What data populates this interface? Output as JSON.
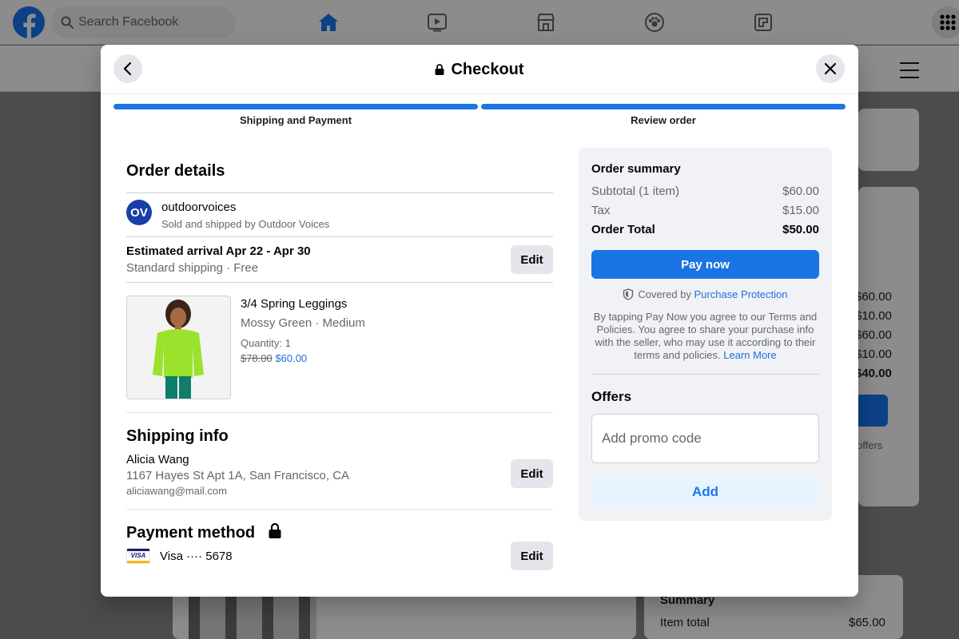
{
  "topbar": {
    "search_placeholder": "Search Facebook",
    "nav_icons": [
      "home-icon",
      "watch-icon",
      "marketplace-icon",
      "groups-icon",
      "gaming-icon"
    ]
  },
  "background": {
    "side_values": [
      "$60.00",
      "$10.00",
      "$60.00",
      "$10.00",
      "$40.00"
    ],
    "offers_fragment": "offers",
    "summary_title": "Summary",
    "item_total_label": "Item total",
    "item_total_value": "$65.00"
  },
  "checkout": {
    "title": "Checkout",
    "steps": [
      {
        "label": "Shipping and Payment"
      },
      {
        "label": "Review order"
      }
    ],
    "order_details": {
      "heading": "Order details",
      "seller": {
        "avatar_text": "OV",
        "name": "outdoorvoices",
        "subtitle": "Sold and shipped by Outdoor Voices"
      },
      "arrival": {
        "title": "Estimated arrival Apr 22 - Apr 30",
        "subtitle": "Standard shipping · Free",
        "edit_label": "Edit"
      },
      "product": {
        "name": "3/4 Spring Leggings",
        "variant": "Mossy Green · Medium",
        "quantity": "Quantity: 1",
        "old_price": "$78.00",
        "price": "$60.00"
      }
    },
    "shipping": {
      "heading": "Shipping info",
      "name": "Alicia Wang",
      "address": "1167 Hayes St Apt 1A, San Francisco, CA",
      "email": "aliciawang@mail.com",
      "edit_label": "Edit"
    },
    "payment": {
      "heading": "Payment method",
      "card_brand": "VISA",
      "card_text": "Visa ···· 5678",
      "edit_label": "Edit"
    },
    "summary": {
      "heading": "Order summary",
      "rows": [
        {
          "label": "Subtotal (1 item)",
          "value": "$60.00"
        },
        {
          "label": "Tax",
          "value": "$15.00"
        },
        {
          "label": "Order Total",
          "value": "$50.00"
        }
      ],
      "pay_label": "Pay now",
      "protection_prefix": "Covered by",
      "protection_link": "Purchase Protection",
      "terms_text": "By tapping Pay Now you agree to our Terms and Policies. You agree to share your purchase info with the seller, who may use it according to their terms and policies.",
      "learn_more": "Learn More",
      "offers_heading": "Offers",
      "promo_placeholder": "Add promo code",
      "add_label": "Add"
    }
  },
  "colors": {
    "accent": "#1b74e4",
    "facebook_blue": "#1877f2",
    "product_color": "#9be22d"
  }
}
